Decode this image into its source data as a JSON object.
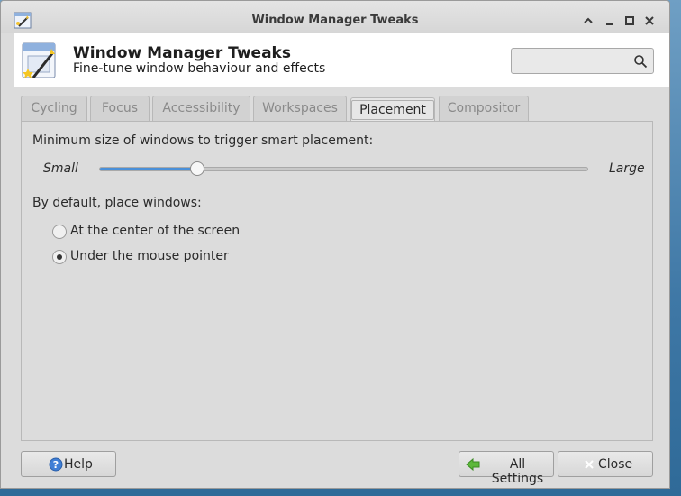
{
  "window": {
    "title": "Window Manager Tweaks"
  },
  "header": {
    "title": "Window Manager Tweaks",
    "subtitle": "Fine-tune window behaviour and effects",
    "search_value": ""
  },
  "tabs": [
    {
      "label": "Cycling",
      "active": false
    },
    {
      "label": "Focus",
      "active": false
    },
    {
      "label": "Accessibility",
      "active": false
    },
    {
      "label": "Workspaces",
      "active": false
    },
    {
      "label": "Placement",
      "active": true
    },
    {
      "label": "Compositor",
      "active": false
    }
  ],
  "placement": {
    "size_label": "Minimum size of windows to trigger smart placement:",
    "slider_min_label": "Small",
    "slider_max_label": "Large",
    "slider_value": 0.2,
    "default_label": "By default, place windows:",
    "options": [
      {
        "label": "At the center of the screen",
        "checked": false
      },
      {
        "label": "Under the mouse pointer",
        "checked": true
      }
    ]
  },
  "buttons": {
    "help": "Help",
    "all_settings": "All Settings",
    "close": "Close"
  },
  "icons": {
    "app": "window-manager-tweaks-icon",
    "search": "search-icon",
    "help": "help-icon",
    "all_settings": "back-arrow-icon",
    "close": "close-icon"
  },
  "colors": {
    "accent": "#4a90d9",
    "desktop": "#3f78a6"
  }
}
